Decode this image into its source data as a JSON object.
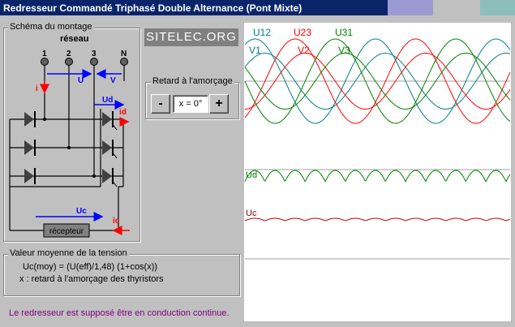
{
  "window": {
    "title": "Redresseur Commandé Triphasé Double Alternance (Pont Mixte)",
    "title_color": "#0a246a",
    "stripe_colors": [
      "#9b9bd3",
      "#c0c0c0",
      "#8ebeba",
      "#c0c0c0"
    ]
  },
  "schema": {
    "group_label": "Schéma du montage",
    "network_label": "réseau",
    "terminals": [
      "1",
      "2",
      "3",
      "N"
    ],
    "labels": {
      "i": "i",
      "U": "U",
      "V": "V",
      "Ud": "Ud",
      "id": "id",
      "Uc": "Uc",
      "ic": "ic",
      "receiver": "récepteur"
    },
    "colors": {
      "arrow_blue": "#0000ff",
      "arrow_red": "#ff0000",
      "receiver_fill": "#808080"
    }
  },
  "logo": {
    "text": "SITELEC.ORG"
  },
  "firing": {
    "group_label": "Retard à l'amorçage",
    "minus_label": "-",
    "plus_label": "+",
    "value": "x = 0°"
  },
  "formula": {
    "group_label": "Valeur moyenne de la tension",
    "line1": "Uc(moy) = (U(eff)/1,48) (1+cos(x))",
    "line2": "x : retard à l'amorçage des thyristors"
  },
  "note": {
    "text": "Le redresseur est supposé être en conduction continue.",
    "color": "#800080"
  },
  "scope": {
    "top_labels": {
      "U12": "U12",
      "U23": "U23",
      "U31": "U31",
      "V1": "V1",
      "V2": "V2",
      "V3": "V3"
    },
    "bottom_labels": {
      "Ud": "Ud",
      "Uc": "Uc"
    },
    "colors": {
      "phase1": "#008080",
      "phase2": "#ff0000",
      "phase3": "#008000",
      "ud": "#008000",
      "uc": "#c00000",
      "axis": "#a0a0a0"
    },
    "line_voltage_amplitude": 1.0,
    "phase_voltage_amplitude": 0.577,
    "periods_shown": 2.2
  }
}
